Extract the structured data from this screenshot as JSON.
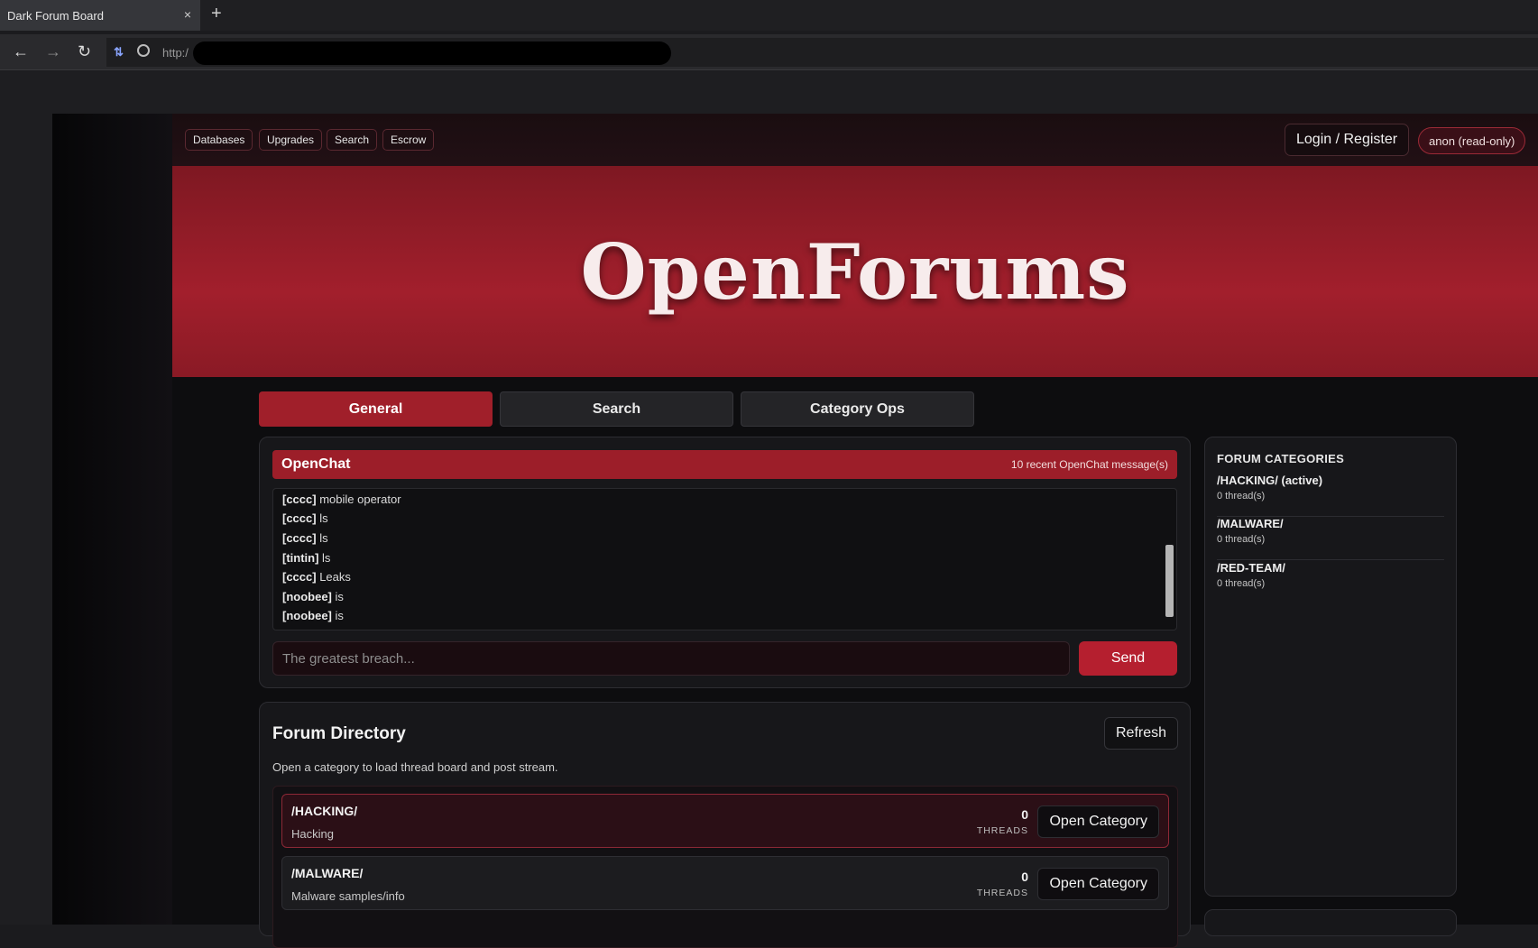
{
  "browser": {
    "tab_title": "Dark Forum Board",
    "tab_close": "×",
    "new_tab": "+",
    "url_prefix": "http:/"
  },
  "topnav": {
    "links": [
      "Databases",
      "Upgrades",
      "Search",
      "Escrow"
    ],
    "login_label": "Login / Register",
    "user_badge": "anon (read-only)"
  },
  "hero": {
    "title": "OpenForums"
  },
  "tabs": [
    {
      "label": "General",
      "active": true
    },
    {
      "label": "Search",
      "active": false
    },
    {
      "label": "Category Ops",
      "active": false
    }
  ],
  "chat": {
    "title": "OpenChat",
    "count_text": "10 recent OpenChat message(s)",
    "messages": [
      {
        "user": "[cccc]",
        "text": "mobile operator"
      },
      {
        "user": "[cccc]",
        "text": "ls"
      },
      {
        "user": "[cccc]",
        "text": "ls"
      },
      {
        "user": "[tintin]",
        "text": "ls"
      },
      {
        "user": "[cccc]",
        "text": "Leaks"
      },
      {
        "user": "[noobee]",
        "text": "is"
      },
      {
        "user": "[noobee]",
        "text": "is"
      }
    ],
    "input_placeholder": "The greatest breach...",
    "send_label": "Send"
  },
  "directory": {
    "title": "Forum Directory",
    "refresh_label": "Refresh",
    "description": "Open a category to load thread board and post stream.",
    "categories": [
      {
        "name": "/HACKING/",
        "desc": "Hacking",
        "count": "0",
        "unit": "THREADS",
        "button": "Open Category",
        "active": true
      },
      {
        "name": "/MALWARE/",
        "desc": "Malware samples/info",
        "count": "0",
        "unit": "THREADS",
        "button": "Open Category",
        "active": false
      }
    ]
  },
  "sidebar": {
    "title": "FORUM CATEGORIES",
    "items": [
      {
        "name": "/HACKING/ (active)",
        "count": "0 thread(s)"
      },
      {
        "name": "/MALWARE/",
        "count": "0 thread(s)"
      },
      {
        "name": "/RED-TEAM/",
        "count": "0 thread(s)"
      }
    ]
  },
  "colors": {
    "accent": "#a01f2a",
    "hero": "#a21f2c",
    "background": "#0d0d0f"
  }
}
